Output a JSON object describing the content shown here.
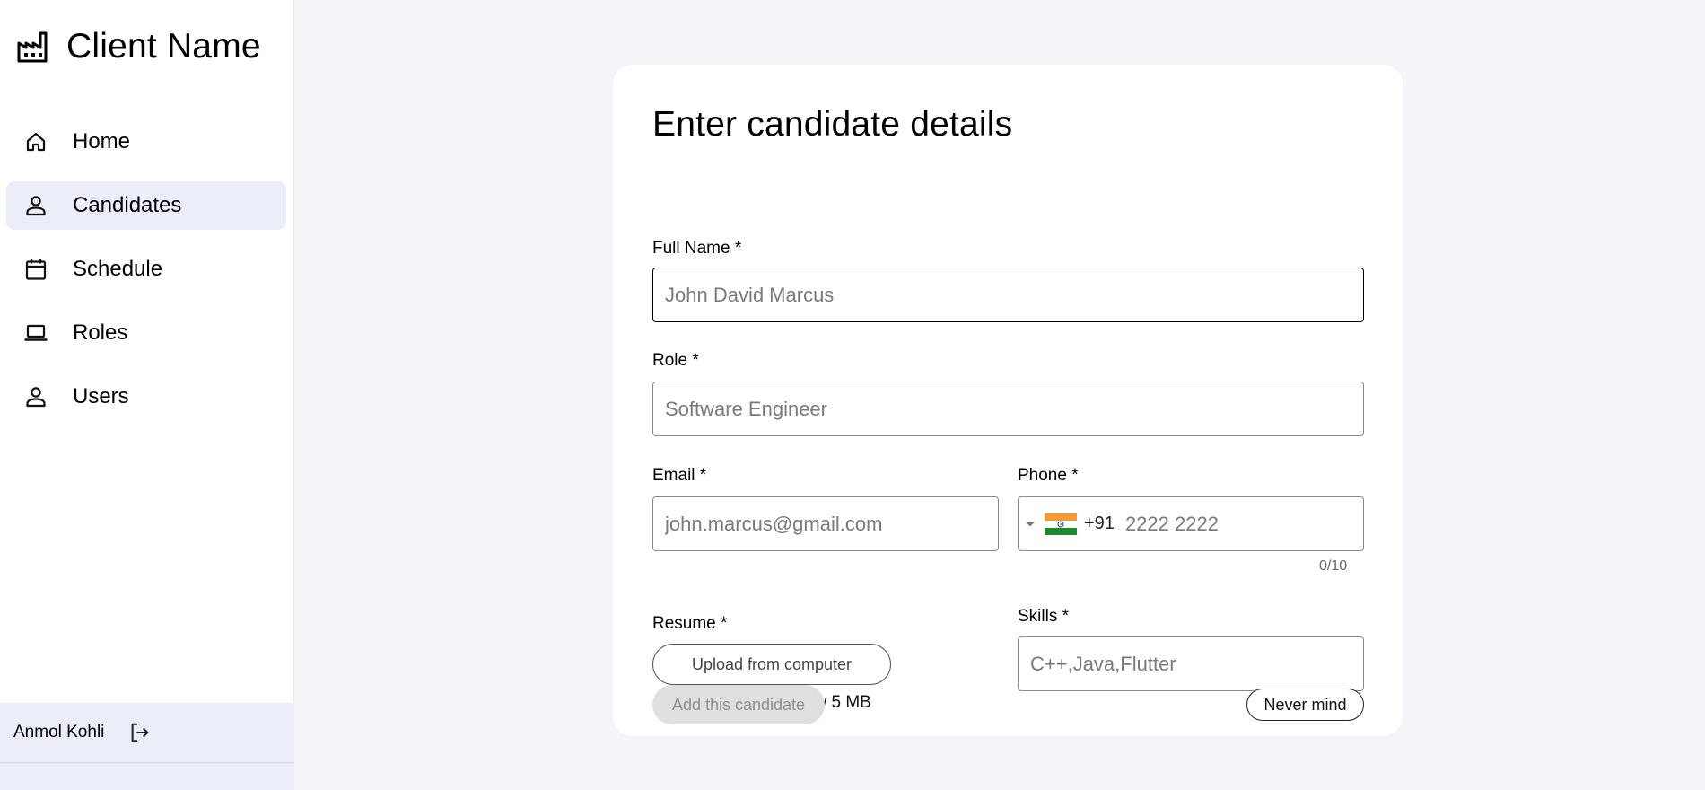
{
  "sidebar": {
    "brand": {
      "name": "Client Name",
      "icon": "factory-icon"
    },
    "items": [
      {
        "label": "Home",
        "icon": "home-icon",
        "active": false
      },
      {
        "label": "Candidates",
        "icon": "person-icon",
        "active": true
      },
      {
        "label": "Schedule",
        "icon": "calendar-icon",
        "active": false
      },
      {
        "label": "Roles",
        "icon": "laptop-icon",
        "active": false
      },
      {
        "label": "Users",
        "icon": "person-icon",
        "active": false
      }
    ],
    "user": {
      "name": "Anmol Kohli",
      "logout_icon": "logout-icon"
    }
  },
  "form": {
    "title": "Enter candidate details",
    "full_name": {
      "label": "Full Name *",
      "placeholder": "John David Marcus",
      "value": ""
    },
    "role": {
      "label": "Role *",
      "placeholder": "Software Engineer",
      "value": ""
    },
    "email": {
      "label": "Email *",
      "placeholder": "john.marcus@gmail.com",
      "value": ""
    },
    "phone": {
      "label": "Phone *",
      "dial_code": "+91",
      "placeholder": "2222 2222",
      "value": "",
      "counter": "0/10",
      "country_flag": "india-flag-icon"
    },
    "resume": {
      "label": "Resume *",
      "button_label": "Upload from computer",
      "note": "File should be below 5 MB"
    },
    "skills": {
      "label": "Skills *",
      "placeholder": "C++,Java,Flutter",
      "value": ""
    },
    "actions": {
      "submit_label": "Add this candidate",
      "cancel_label": "Never mind"
    }
  },
  "colors": {
    "background": "#f4f5f8",
    "active_nav": "#ebeef9",
    "disabled_button": "#e0e0e0",
    "flag_saffron": "#f39a32",
    "flag_green": "#1e8a2e",
    "flag_chakra": "#1a3a8a"
  }
}
